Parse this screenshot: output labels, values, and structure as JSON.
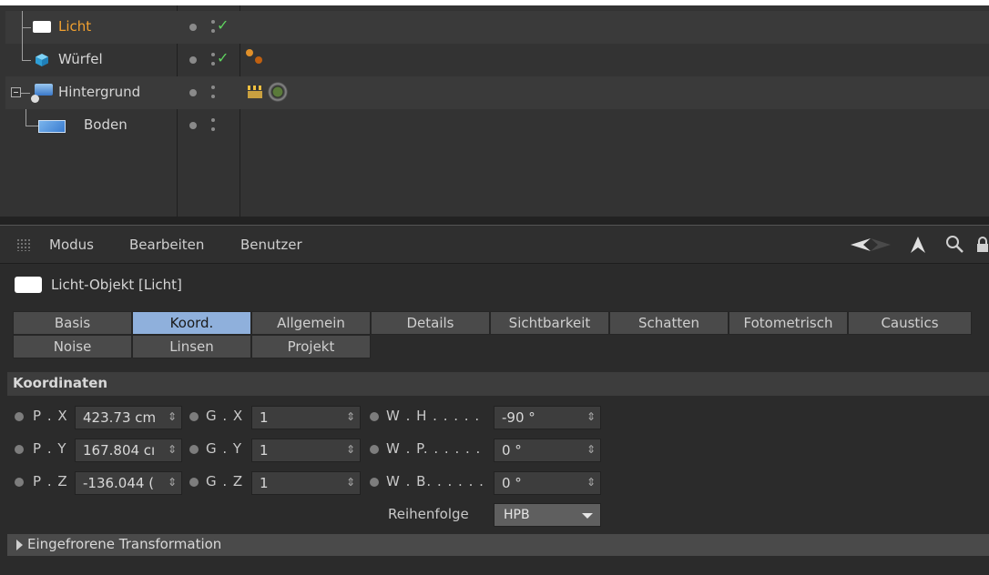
{
  "object_manager": {
    "objects": [
      {
        "name": "Licht",
        "icon": "light-icon",
        "active": true,
        "check": "✓",
        "tags": []
      },
      {
        "name": "Würfel",
        "icon": "cube-icon",
        "active": false,
        "check": "✓",
        "tags": [
          "material-tag-icon"
        ]
      },
      {
        "name": "Hintergrund",
        "icon": "background-icon",
        "active": false,
        "check": "",
        "tags": [
          "clapper-tag-icon",
          "texture-tag-icon"
        ]
      },
      {
        "name": "Boden",
        "icon": "floor-icon",
        "active": false,
        "check": "",
        "tags": []
      }
    ]
  },
  "attribute_manager": {
    "menu": [
      "Modus",
      "Bearbeiten",
      "Benutzer"
    ],
    "object_title": "Licht-Objekt [Licht]",
    "tabs_row1": [
      "Basis",
      "Koord.",
      "Allgemein",
      "Details",
      "Sichtbarkeit",
      "Schatten",
      "Fotometrisch",
      "Caustics"
    ],
    "tabs_row2": [
      "Noise",
      "Linsen",
      "Projekt"
    ],
    "active_tab": "Koord.",
    "section": "Koordinaten",
    "position": [
      {
        "label": "P . X",
        "value": "423.73 cm"
      },
      {
        "label": "P . Y",
        "value": "167.804 cı"
      },
      {
        "label": "P . Z",
        "value": "-136.044 ("
      }
    ],
    "scale": [
      {
        "label": "G . X",
        "value": "1"
      },
      {
        "label": "G . Y",
        "value": "1"
      },
      {
        "label": "G . Z",
        "value": "1"
      }
    ],
    "rotation": [
      {
        "label": "W . H . . . . .",
        "value": "-90 °"
      },
      {
        "label": "W . P. . . . . .",
        "value": "0 °"
      },
      {
        "label": "W . B. . . . . .",
        "value": "0 °"
      }
    ],
    "order_label": "Reihenfolge",
    "order_value": "HPB",
    "frozen_label": "Eingefrorene Transformation"
  },
  "colors": {
    "active_object": "#f0a030",
    "active_tab": "#8fb0dc",
    "check": "#5fd35f"
  }
}
